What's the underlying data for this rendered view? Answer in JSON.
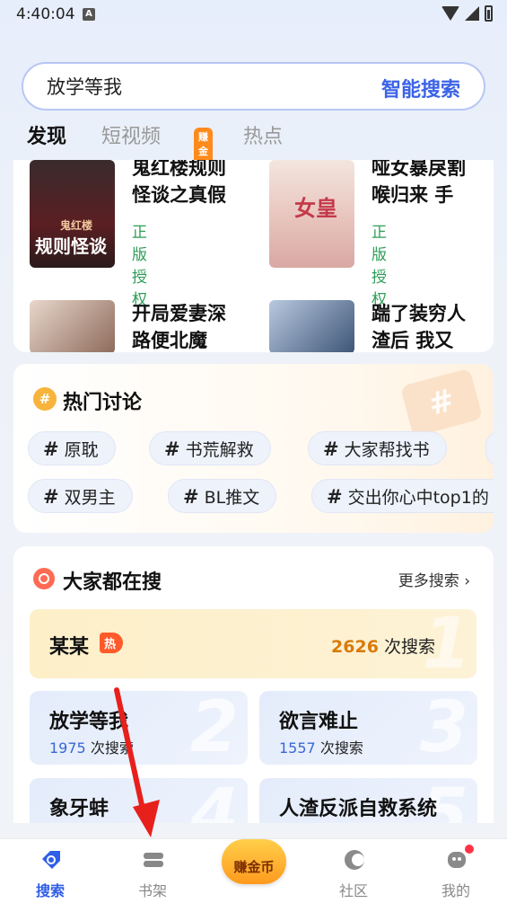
{
  "status": {
    "time": "4:40:04",
    "badge": "A"
  },
  "search": {
    "query": "放学等我",
    "button": "智能搜索"
  },
  "tabs": [
    {
      "label": "发现",
      "active": true
    },
    {
      "label": "短视频",
      "badge": "赚金币"
    },
    {
      "label": "热点"
    }
  ],
  "books": [
    {
      "title": "鬼红楼规则怪谈之真假",
      "tag": "正版授权",
      "cover_text": "规则怪谈",
      "cover_top": "鬼红楼"
    },
    {
      "title": "哑女暴戾割喉归来 手",
      "tag": "正版授权",
      "cover_text": "女皇"
    },
    {
      "title": "开局爱妻深路便北魔",
      "tag": ""
    },
    {
      "title": "踹了装穷人渣后 我又",
      "tag": ""
    }
  ],
  "hot_discussion": {
    "title": "热门讨论",
    "row1": [
      "原耽",
      "书荒解救",
      "大家帮找书"
    ],
    "row2": [
      "双男主",
      "BL推文",
      "交出你心中top1的"
    ]
  },
  "trending": {
    "title": "大家都在搜",
    "more": "更多搜索",
    "top": {
      "name": "某某",
      "badge": "热",
      "count": "2626",
      "suffix": "次搜索",
      "rank": "1"
    },
    "items": [
      {
        "name": "放学等我",
        "count": "1975",
        "suffix": "次搜索",
        "rank": "2"
      },
      {
        "name": "欲言难止",
        "count": "1557",
        "suffix": "次搜索",
        "rank": "3"
      },
      {
        "name": "象牙蚌",
        "count": "",
        "suffix": "",
        "rank": "4"
      },
      {
        "name": "人渣反派自救系统",
        "count": "",
        "suffix": "",
        "rank": "5"
      }
    ]
  },
  "nav": {
    "search": "搜索",
    "shelf": "书架",
    "earn": "赚金币",
    "community": "社区",
    "mine": "我的"
  },
  "colors": {
    "accent": "#2f5ee8",
    "authorized": "#2f9d57",
    "annotation_arrow": "#e8201c"
  }
}
